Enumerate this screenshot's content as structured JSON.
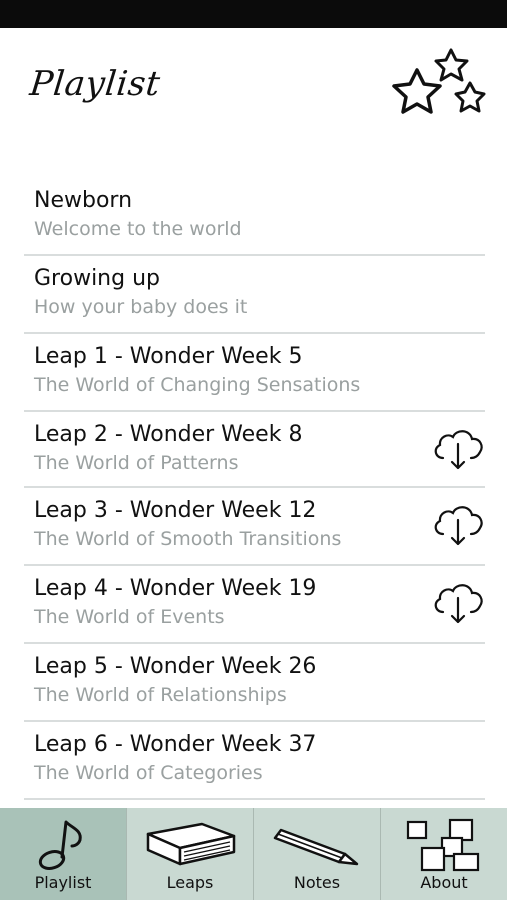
{
  "header": {
    "title": "Playlist"
  },
  "playlist": [
    {
      "title": "Newborn",
      "subtitle": "Welcome to the world",
      "download": false
    },
    {
      "title": "Growing up",
      "subtitle": "How your baby does it",
      "download": false
    },
    {
      "title": "Leap 1 - Wonder Week 5",
      "subtitle": "The World of Changing Sensations",
      "download": false
    },
    {
      "title": "Leap 2 - Wonder Week 8",
      "subtitle": "The World of Patterns",
      "download": true
    },
    {
      "title": "Leap 3 - Wonder Week 12",
      "subtitle": "The World of Smooth Transitions",
      "download": true
    },
    {
      "title": "Leap 4 - Wonder Week 19",
      "subtitle": "The World of Events",
      "download": true
    },
    {
      "title": "Leap 5 - Wonder Week 26",
      "subtitle": "The World of Relationships",
      "download": false
    },
    {
      "title": "Leap 6 - Wonder Week 37",
      "subtitle": "The World of Categories",
      "download": false
    }
  ],
  "tabs": [
    {
      "label": "Playlist",
      "icon": "music-note-icon",
      "active": true
    },
    {
      "label": "Leaps",
      "icon": "book-icon",
      "active": false
    },
    {
      "label": "Notes",
      "icon": "pencil-icon",
      "active": false
    },
    {
      "label": "About",
      "icon": "blocks-icon",
      "active": false
    }
  ],
  "colors": {
    "tab_bar": "#c9d9d2",
    "tab_active": "#a9c2b8",
    "subtitle": "#9aa0a0",
    "divider": "#d9dddd"
  }
}
